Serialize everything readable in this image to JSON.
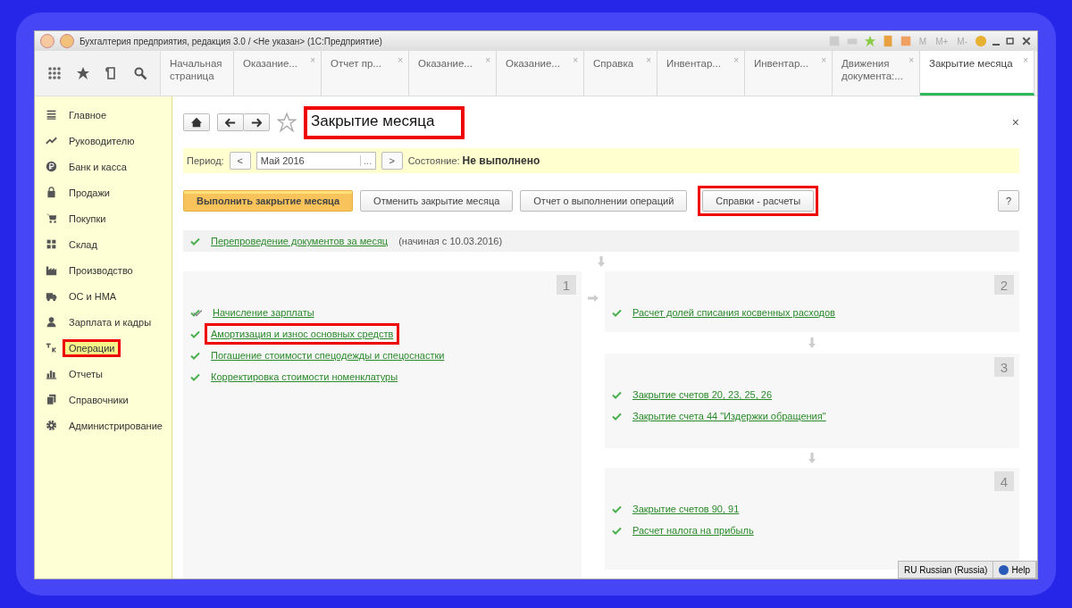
{
  "window": {
    "title": "Бухгалтерия предприятия, редакция 3.0 / <Не указан>  (1С:Предприятие)",
    "memory_buttons": [
      "M",
      "M+",
      "M-"
    ]
  },
  "tabs": [
    {
      "label": "Начальная страница",
      "selected": false
    },
    {
      "label": "Оказание...",
      "selected": false,
      "close": "×"
    },
    {
      "label": "Отчет пр...",
      "selected": false,
      "close": "×"
    },
    {
      "label": "Оказание...",
      "selected": false,
      "close": "×"
    },
    {
      "label": "Оказание...",
      "selected": false,
      "close": "×"
    },
    {
      "label": "Справка",
      "selected": false,
      "close": "×"
    },
    {
      "label": "Инвентар...",
      "selected": false,
      "close": "×"
    },
    {
      "label": "Инвентар...",
      "selected": false,
      "close": "×"
    },
    {
      "label": "Движения документа:...",
      "selected": false,
      "close": "×"
    },
    {
      "label": "Закрытие месяца",
      "selected": true,
      "close": "×"
    }
  ],
  "sidebar": {
    "items": [
      {
        "label": "Главное",
        "selected": false,
        "highlighted": false
      },
      {
        "label": "Руководителю",
        "selected": false,
        "highlighted": false
      },
      {
        "label": "Банк и касса",
        "selected": false,
        "highlighted": false
      },
      {
        "label": "Продажи",
        "selected": false,
        "highlighted": false
      },
      {
        "label": "Покупки",
        "selected": false,
        "highlighted": false
      },
      {
        "label": "Склад",
        "selected": false,
        "highlighted": false
      },
      {
        "label": "Производство",
        "selected": false,
        "highlighted": false
      },
      {
        "label": "ОС и НМА",
        "selected": false,
        "highlighted": false
      },
      {
        "label": "Зарплата и кадры",
        "selected": false,
        "highlighted": false
      },
      {
        "label": "Операции",
        "selected": true,
        "highlighted": true
      },
      {
        "label": "Отчеты",
        "selected": false,
        "highlighted": false
      },
      {
        "label": "Справочники",
        "selected": false,
        "highlighted": false
      },
      {
        "label": "Администрирование",
        "selected": false,
        "highlighted": false
      }
    ]
  },
  "form": {
    "title": "Закрытие месяца",
    "title_highlighted": true,
    "close": "×",
    "period": {
      "label": "Период:",
      "prev": "<",
      "value": "Май 2016",
      "choose": "...",
      "next": ">",
      "state_label": "Состояние:",
      "state": "Не выполнено"
    },
    "buttons": [
      {
        "label": "Выполнить закрытие месяца",
        "kind": "primary",
        "highlighted": false
      },
      {
        "label": "Отменить закрытие месяца",
        "kind": "normal",
        "highlighted": false
      },
      {
        "label": "Отчет о выполнении операций",
        "kind": "normal",
        "highlighted": false
      },
      {
        "label": "Справки - расчеты",
        "kind": "normal",
        "highlighted": true
      }
    ],
    "help": "?",
    "pre_step": {
      "label": "Перепроведение документов за месяц",
      "note": "(начиная с 10.03.2016)",
      "kind": "check"
    },
    "stages": [
      {
        "number": "1",
        "steps": [
          {
            "label": "Начисление зарплаты",
            "kind": "double-check",
            "highlighted": false
          },
          {
            "label": "Амортизация и износ основных средств",
            "kind": "check",
            "highlighted": true
          },
          {
            "label": "Погашение стоимости спецодежды и спецоснастки",
            "kind": "check",
            "highlighted": false
          },
          {
            "label": "Корректировка стоимости номенклатуры",
            "kind": "check",
            "highlighted": false
          }
        ]
      },
      {
        "number": "2",
        "steps": [
          {
            "label": "Расчет долей списания косвенных расходов",
            "kind": "check",
            "highlighted": false
          }
        ]
      },
      {
        "number": "3",
        "steps": [
          {
            "label": "Закрытие счетов 20, 23, 25, 26",
            "kind": "check",
            "highlighted": false
          },
          {
            "label": "Закрытие счета 44 \"Издержки обращения\"",
            "kind": "check",
            "highlighted": false
          }
        ]
      },
      {
        "number": "4",
        "steps": [
          {
            "label": "Закрытие счетов 90, 91",
            "kind": "check",
            "highlighted": false
          },
          {
            "label": "Расчет налога на прибыль",
            "kind": "check",
            "highlighted": false
          }
        ]
      }
    ]
  },
  "language_bar": {
    "language": "RU Russian (Russia)",
    "help": "Help"
  }
}
